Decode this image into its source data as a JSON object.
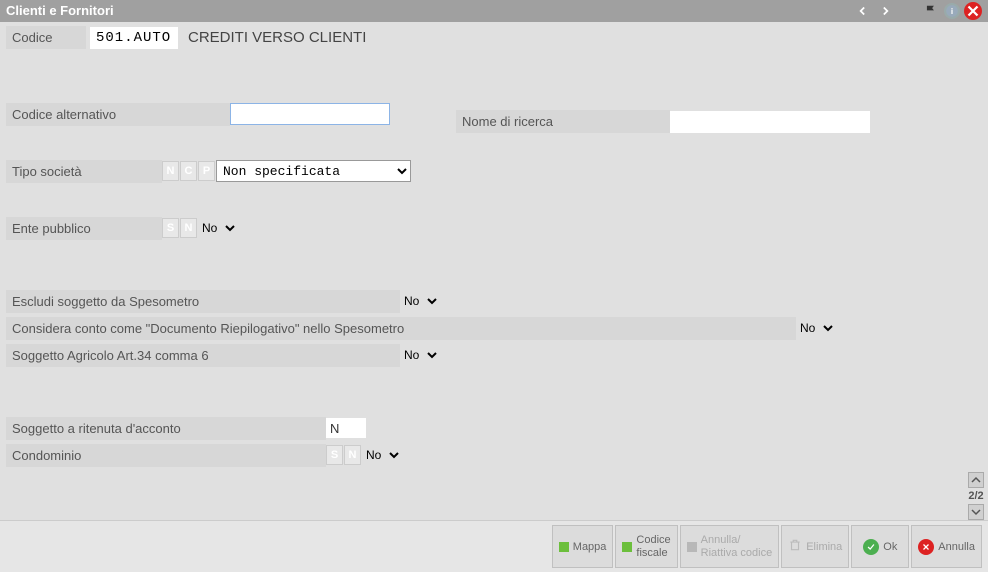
{
  "window": {
    "title": "Clienti e Fornitori"
  },
  "header": {
    "codice_label": "Codice",
    "codice_value": "501.AUTO",
    "description": "CREDITI VERSO CLIENTI"
  },
  "fields": {
    "codice_alt_label": "Codice alternativo",
    "codice_alt_value": "",
    "nome_ricerca_label": "Nome di ricerca",
    "nome_ricerca_value": "",
    "tipo_societa_label": "Tipo società",
    "tipo_societa_letters": {
      "n": "N",
      "c": "C",
      "p": "P"
    },
    "tipo_societa_value": "Non specificata",
    "ente_pubblico_label": "Ente pubblico",
    "ente_letters": {
      "s": "S",
      "n": "N"
    },
    "ente_value": "No",
    "escludi_spes_label": "Escludi soggetto da Spesometro",
    "escludi_spes_value": "No",
    "doc_riepilogativo_label": "Considera conto come \"Documento Riepilogativo\" nello Spesometro",
    "doc_riepilogativo_value": "No",
    "agricolo_label": "Soggetto Agricolo Art.34 comma 6",
    "agricolo_value": "No",
    "ritenuta_label": "Soggetto a ritenuta d'acconto",
    "ritenuta_value": "N",
    "condominio_label": "Condominio",
    "condominio_letters": {
      "s": "S",
      "n": "N"
    },
    "condominio_value": "No"
  },
  "paging": {
    "indicator": "2/2"
  },
  "footer": {
    "mappa": "Mappa",
    "codice_fiscale_l1": "Codice",
    "codice_fiscale_l2": "fiscale",
    "annulla_riattiva_l1": "Annulla/",
    "annulla_riattiva_l2": "Riattiva codice",
    "elimina": "Elimina",
    "ok": "Ok",
    "annulla": "Annulla"
  }
}
